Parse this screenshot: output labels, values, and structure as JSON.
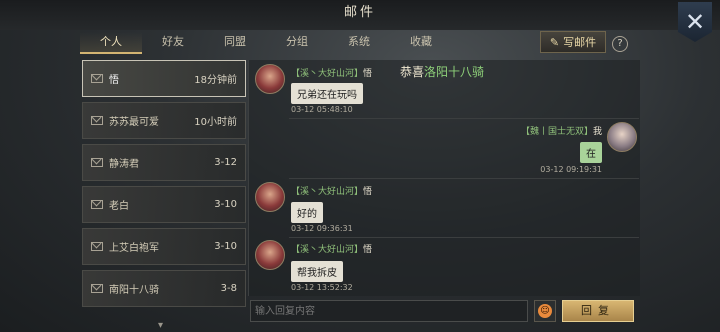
{
  "header": {
    "title": "邮件"
  },
  "tabs": [
    "个人",
    "好友",
    "同盟",
    "分组",
    "系统",
    "收藏"
  ],
  "toolbar": {
    "write_label": "写邮件",
    "help_label": "?"
  },
  "conversations": [
    {
      "name": "悟",
      "time": "18分钟前"
    },
    {
      "name": "苏苏最可爱",
      "time": "10小时前"
    },
    {
      "name": "静涛君",
      "time": "3-12"
    },
    {
      "name": "老白",
      "time": "3-10"
    },
    {
      "name": "上艾白袍军",
      "time": "3-10"
    },
    {
      "name": "南阳十八骑",
      "time": "3-8"
    }
  ],
  "marquee": {
    "prefix": "恭喜",
    "highlight": "洛阳十八骑"
  },
  "messages": [
    {
      "tag": "【溪丶大好山河】",
      "nick": "悟",
      "text": "兄弟还在玩吗",
      "time": "03-12 05:48:10",
      "mine": false
    },
    {
      "tag": "【魏丨国士无双】",
      "nick": "我",
      "text": "在",
      "time": "03-12 09:19:31",
      "mine": true
    },
    {
      "tag": "【溪丶大好山河】",
      "nick": "悟",
      "text": "好的",
      "time": "03-12 09:36:31",
      "mine": false
    },
    {
      "tag": "【溪丶大好山河】",
      "nick": "悟",
      "text": "帮我拆皮",
      "time": "03-12 13:52:32",
      "mine": false
    }
  ],
  "reply": {
    "placeholder": "输入回复内容",
    "button_label": "回复"
  },
  "colors": {
    "accent": "#d3b472",
    "guild_tag": "#8fc07a",
    "my_bubble": "#a9d39a"
  }
}
